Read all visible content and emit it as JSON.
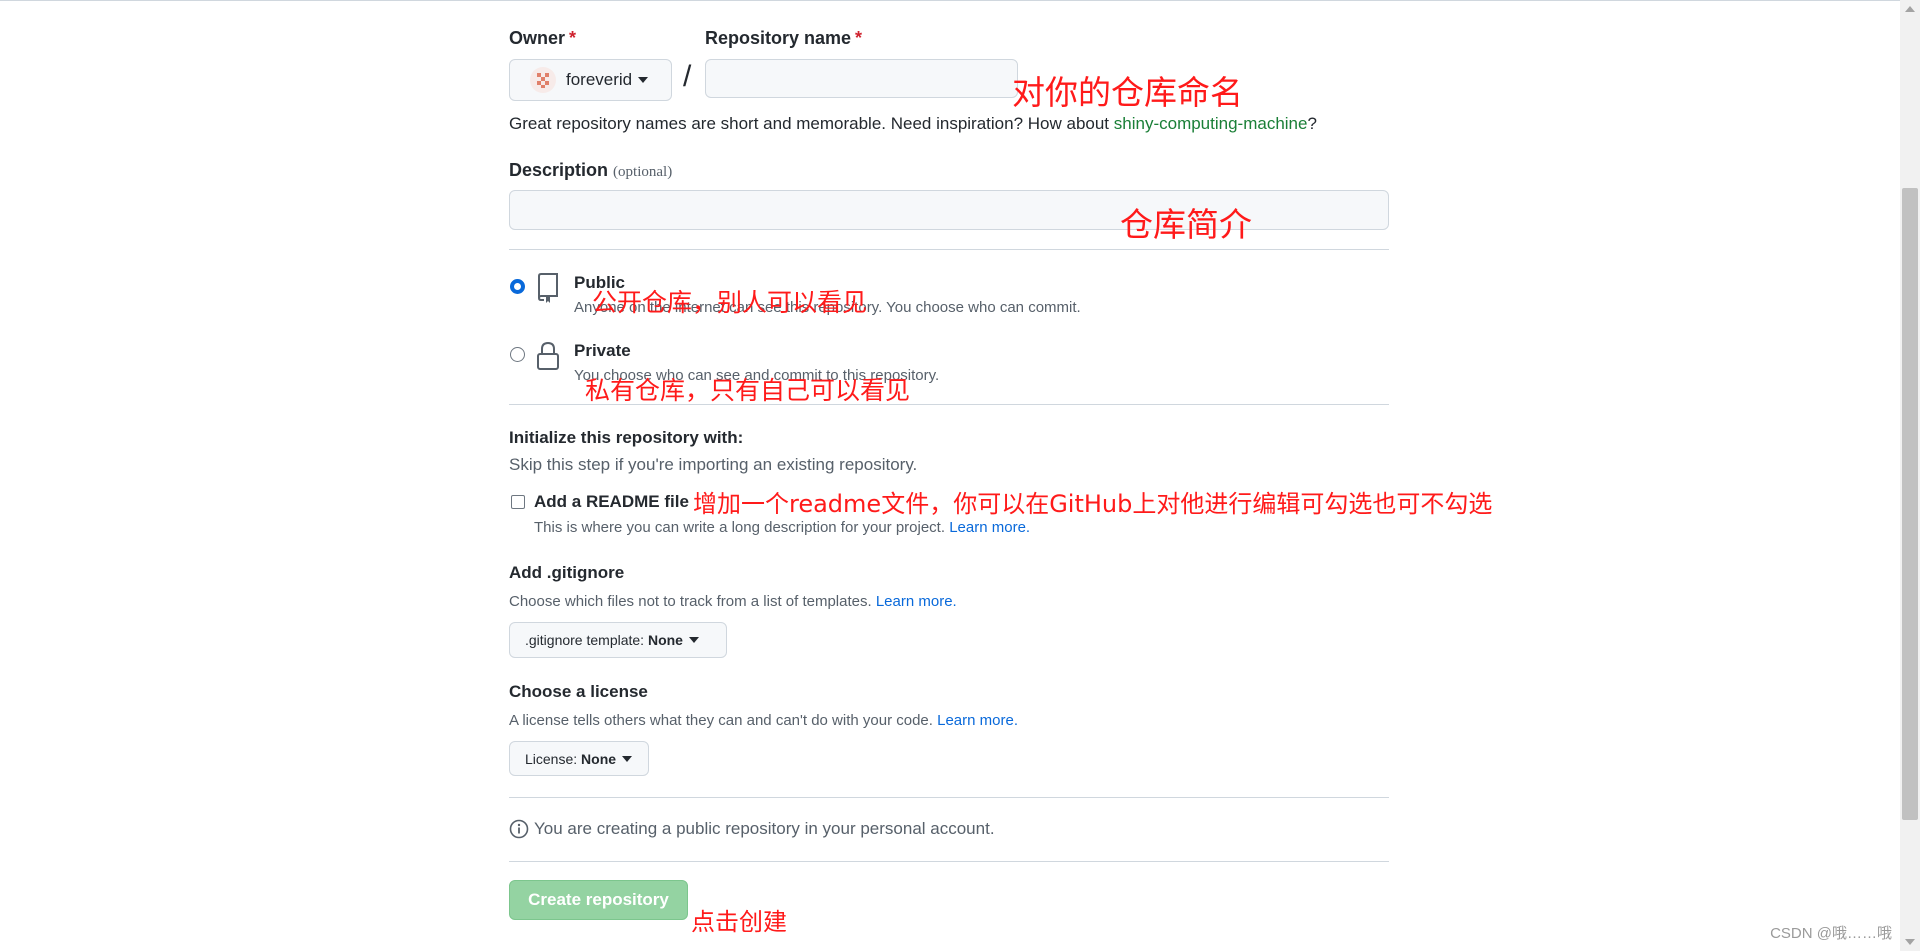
{
  "owner": {
    "label": "Owner",
    "required_mark": "*",
    "value": "foreverid"
  },
  "repo": {
    "label": "Repository name",
    "required_mark": "*",
    "value": "",
    "separator": "/"
  },
  "name_hint": {
    "text": "Great repository names are short and memorable. Need inspiration? How about ",
    "suggestion": "shiny-computing-machine",
    "end": "?"
  },
  "description": {
    "label": "Description",
    "optional": "(optional)",
    "value": ""
  },
  "visibility": {
    "public": {
      "title": "Public",
      "desc": "Anyone on the internet can see this repository. You choose who can commit."
    },
    "private": {
      "title": "Private",
      "desc": "You choose who can see and commit to this repository."
    },
    "selected": "public"
  },
  "init": {
    "title": "Initialize this repository with:",
    "subtitle": "Skip this step if you're importing an existing repository."
  },
  "readme": {
    "label": "Add a README file",
    "desc": "This is where you can write a long description for your project.",
    "learn_more": "Learn more."
  },
  "gitignore": {
    "title": "Add .gitignore",
    "desc": "Choose which files not to track from a list of templates.",
    "learn_more": "Learn more.",
    "button_prefix": ".gitignore template:",
    "button_value": "None"
  },
  "license": {
    "title": "Choose a license",
    "desc": "A license tells others what they can and can't do with your code.",
    "learn_more": "Learn more.",
    "button_prefix": "License:",
    "button_value": "None"
  },
  "notice": "You are creating a public repository in your personal account.",
  "create_button": "Create repository",
  "annotations": {
    "repo_name": "对你的仓库命名",
    "description": "仓库简介",
    "public": "公开仓库，别人可以看见",
    "private": "私有仓库，只有自己可以看见",
    "readme": "增加一个readme文件，你可以在GitHub上对他进行编辑可勾选也可不勾选",
    "create": "点击创建"
  },
  "watermark": "CSDN @哦……哦",
  "colors": {
    "annotation": "#ff1a1a",
    "link": "#0969da",
    "suggestion": "#1a7f37",
    "create_button": "#94d3a2"
  }
}
